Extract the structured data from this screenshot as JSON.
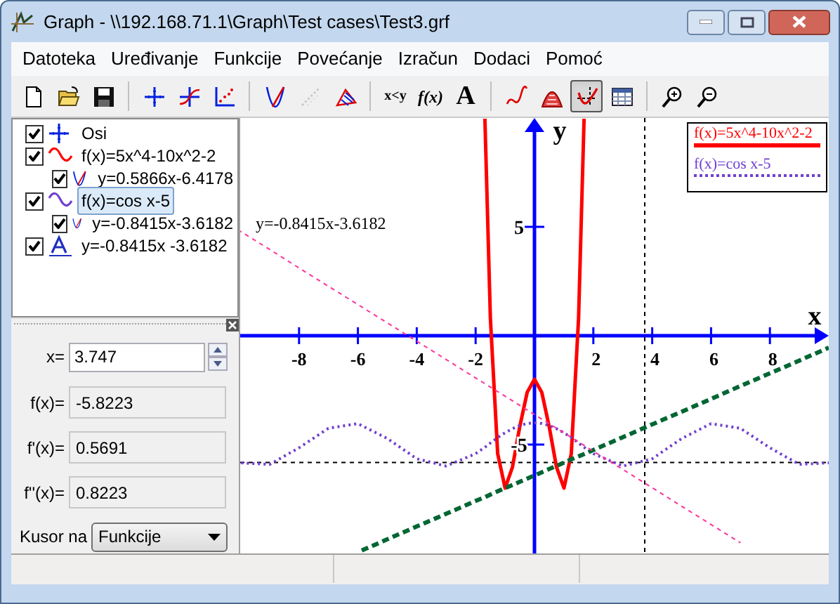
{
  "window": {
    "title": "Graph - \\\\192.168.71.1\\Graph\\Test cases\\Test3.grf"
  },
  "menu": [
    "Datoteka",
    "Uređivanje",
    "Funkcije",
    "Povećanje",
    "Izračun",
    "Dodaci",
    "Pomoć"
  ],
  "toolbar": [
    [
      {
        "kind": "new",
        "pressed": false,
        "disabled": false
      },
      {
        "kind": "open",
        "pressed": false,
        "disabled": false
      },
      {
        "kind": "save",
        "pressed": false,
        "disabled": false
      }
    ],
    [
      {
        "kind": "axes",
        "pressed": false,
        "disabled": false
      },
      {
        "kind": "function",
        "pressed": false,
        "disabled": false
      },
      {
        "kind": "points",
        "pressed": false,
        "disabled": false
      }
    ],
    [
      {
        "kind": "tangent",
        "pressed": false,
        "disabled": false
      },
      {
        "kind": "dots",
        "pressed": false,
        "disabled": true
      },
      {
        "kind": "shading",
        "pressed": false,
        "disabled": false
      }
    ],
    [
      {
        "kind": "text",
        "label": "x<y",
        "pressed": false,
        "disabled": false
      },
      {
        "kind": "text",
        "label": "f(x)",
        "pressed": false,
        "disabled": false
      },
      {
        "kind": "text",
        "label": "A",
        "pressed": false,
        "disabled": false
      }
    ],
    [
      {
        "kind": "trend",
        "pressed": false,
        "disabled": false
      },
      {
        "kind": "area",
        "pressed": false,
        "disabled": false
      },
      {
        "kind": "evaluate",
        "pressed": true,
        "disabled": false
      },
      {
        "kind": "table",
        "pressed": false,
        "disabled": false
      }
    ],
    [
      {
        "kind": "zoom-in",
        "pressed": false,
        "disabled": false
      },
      {
        "kind": "zoom-out",
        "pressed": false,
        "disabled": false
      }
    ]
  ],
  "tree": [
    {
      "kind": "axes",
      "label": "Osi",
      "checked": true,
      "selected": false
    },
    {
      "kind": "function",
      "label": "f(x)=5x^4-10x^2-2",
      "checked": true,
      "selected": false,
      "color": "#ff0000",
      "children": [
        {
          "kind": "tangent",
          "label": "y=0.5866x-6.4178",
          "checked": true,
          "selected": false
        }
      ]
    },
    {
      "kind": "function",
      "label": "f(x)=cos x-5",
      "checked": true,
      "selected": true,
      "color": "#7040d0",
      "children": [
        {
          "kind": "tangent",
          "label": "y=-0.8415x-3.6182",
          "checked": true,
          "selected": false
        }
      ]
    },
    {
      "kind": "label",
      "label": "y=-0.8415x -3.6182",
      "checked": true,
      "selected": false
    }
  ],
  "evaluate": {
    "x_label": "x=",
    "x_value": "3.747",
    "results": [
      {
        "label": "f(x)=",
        "value": "-5.8223"
      },
      {
        "label": "f'(x)=",
        "value": "0.5691"
      },
      {
        "label": "f''(x)=",
        "value": "0.8223"
      }
    ],
    "cursor_label": "Kusor na",
    "cursor_value": "Funkcije"
  },
  "graph": {
    "chart_data": {
      "type": "line",
      "xlabel": "x",
      "ylabel": "y",
      "xlim": [
        -10,
        10
      ],
      "ylim": [
        -10,
        10
      ],
      "xticks": [
        -8,
        -6,
        -4,
        -2,
        2,
        4,
        6,
        8
      ],
      "yticks": [
        -5,
        5
      ],
      "x": [
        -10,
        -9,
        -8,
        -7,
        -6,
        -5,
        -4,
        -3,
        -2,
        -1.686,
        -1.5,
        -1.25,
        -1,
        -0.75,
        -0.5,
        -0.25,
        0,
        0.25,
        0.5,
        0.75,
        1,
        1.25,
        1.5,
        1.686,
        2,
        3,
        4,
        5,
        6,
        7,
        8,
        9,
        10
      ],
      "series": [
        {
          "name": "f(x)=5x^4-10x^2-2",
          "color": "#ff0000",
          "line_style": "solid",
          "values": [
            null,
            null,
            null,
            null,
            null,
            null,
            null,
            null,
            null,
            9.97,
            0.81,
            -5.42,
            -7,
            -6.04,
            -4.19,
            -2.6,
            -2,
            -2.6,
            -4.19,
            -6.04,
            -7,
            -5.42,
            0.81,
            9.97,
            null,
            null,
            null,
            null,
            null,
            null,
            null,
            null,
            null
          ]
        },
        {
          "name": "f(x)=cos x-5",
          "color": "#7040d0",
          "line_style": "dotted",
          "values": [
            -5.84,
            -5.91,
            -5.15,
            -4.25,
            -4.04,
            -4.72,
            -5.65,
            -5.99,
            -5.42,
            -5.12,
            -4.93,
            -4.68,
            -4.46,
            -4.27,
            -4.12,
            -4.03,
            -4,
            -4.03,
            -4.12,
            -4.27,
            -4.46,
            -4.68,
            -4.93,
            -5.12,
            -5.42,
            -5.99,
            -5.65,
            -4.72,
            -4.04,
            -4.25,
            -5.15,
            -5.91,
            -5.84
          ]
        },
        {
          "color": "#006633",
          "line_style": "dashed",
          "values": [
            null,
            null,
            null,
            null,
            -9.94,
            -9.35,
            -8.76,
            -8.18,
            -7.59,
            -7.41,
            -7.3,
            -7.15,
            -7,
            -6.86,
            -6.71,
            -6.56,
            -6.42,
            -6.27,
            -6.12,
            -5.98,
            -5.83,
            -5.68,
            -5.54,
            -5.43,
            -5.25,
            -4.66,
            -4.07,
            -3.49,
            -2.9,
            -2.31,
            -1.73,
            -1.14,
            -0.55
          ]
        },
        {
          "color": "#ff3399",
          "line_style": "dashed",
          "values": [
            4.8,
            3.96,
            3.11,
            2.27,
            1.43,
            0.59,
            -0.25,
            -1.09,
            -1.94,
            -2.2,
            -2.36,
            -2.57,
            -2.78,
            -2.99,
            -3.2,
            -3.41,
            -3.62,
            -3.83,
            -4.04,
            -4.25,
            -4.46,
            -4.67,
            -4.88,
            -5.04,
            -5.3,
            -6.14,
            -6.98,
            -7.83,
            -8.67,
            -9.51,
            null,
            null,
            null
          ]
        }
      ],
      "ref_lines": [
        {
          "axis": "x",
          "value": 3.747
        },
        {
          "axis": "y",
          "value": -5.8223
        }
      ],
      "annotations": [
        {
          "text": "y=-0.8415x-3.6182"
        }
      ]
    }
  }
}
